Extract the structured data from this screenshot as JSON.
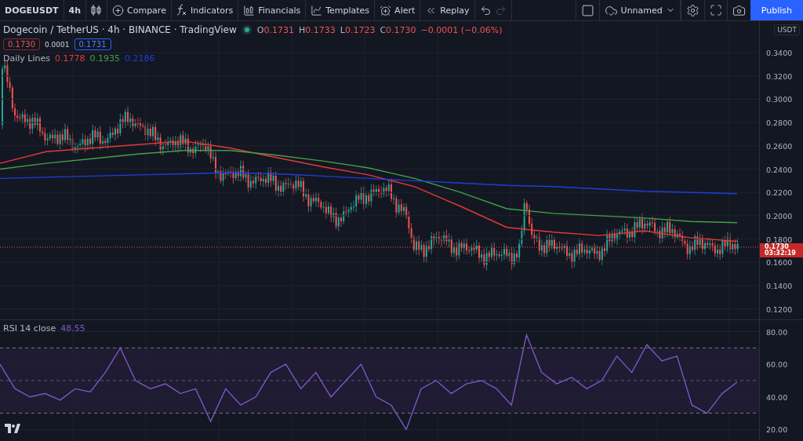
{
  "toolbar": {
    "symbol": "DOGEUSDT",
    "interval": "4h",
    "tools": [
      {
        "kind": "compare",
        "label": "Compare"
      },
      {
        "kind": "indicators",
        "label": "Indicators"
      },
      {
        "kind": "financials",
        "label": "Financials"
      },
      {
        "kind": "templates",
        "label": "Templates"
      },
      {
        "kind": "alert",
        "label": "Alert"
      },
      {
        "kind": "replay",
        "label": "Replay"
      }
    ],
    "layout_name": "Unnamed",
    "publish": "Publish"
  },
  "legend": {
    "title": "Dogecoin / TetherUS · 4h · BINANCE · TradingView",
    "ohlc": [
      {
        "label": "O",
        "value": "0.1731"
      },
      {
        "label": "H",
        "value": "0.1733"
      },
      {
        "label": "L",
        "value": "0.1723"
      },
      {
        "label": "C",
        "value": "0.1730"
      }
    ],
    "change": "−0.0001 (−0.06%)",
    "sell": "0.1730",
    "spread": "0.0001",
    "buy": "0.1731",
    "study": {
      "name": "Daily Lines",
      "values": [
        {
          "value": "0.1778",
          "color": "#e53935"
        },
        {
          "value": "0.1935",
          "color": "#43a047"
        },
        {
          "value": "0.2186",
          "color": "#1e3fd8"
        }
      ]
    }
  },
  "price_axis": {
    "currency": "USDT",
    "last_price": "0.1730",
    "countdown": "03:32:19"
  },
  "chart_data": {
    "type": "line",
    "grid": true,
    "ylim": [
      0.111,
      0.367
    ],
    "categories": [
      null,
      null,
      null,
      null,
      null,
      null,
      null,
      null,
      null,
      null,
      null,
      null,
      null,
      null,
      null,
      null,
      null
    ],
    "yticks": [
      {
        "value": 0.34,
        "label": "0.3400"
      },
      {
        "value": 0.32,
        "label": "0.3200"
      },
      {
        "value": 0.3,
        "label": "0.3000"
      },
      {
        "value": 0.28,
        "label": "0.2800"
      },
      {
        "value": 0.26,
        "label": "0.2600"
      },
      {
        "value": 0.24,
        "label": "0.2400"
      },
      {
        "value": 0.22,
        "label": "0.2200"
      },
      {
        "value": 0.2,
        "label": "0.2000"
      },
      {
        "value": 0.18,
        "label": "0.1800"
      },
      {
        "value": 0.16,
        "label": "0.1600"
      },
      {
        "value": 0.14,
        "label": "0.1400"
      },
      {
        "value": 0.12,
        "label": "0.1200"
      }
    ],
    "series": [
      {
        "color": "#e53935",
        "values": [
          0.245,
          0.255,
          0.258,
          0.261,
          0.264,
          0.258,
          0.25,
          0.242,
          0.235,
          0.225,
          0.208,
          0.19,
          0.186,
          0.183,
          0.187,
          0.181,
          0.178
        ]
      },
      {
        "color": "#43a047",
        "values": [
          0.24,
          0.245,
          0.249,
          0.253,
          0.256,
          0.256,
          0.252,
          0.247,
          0.241,
          0.232,
          0.22,
          0.206,
          0.202,
          0.2,
          0.198,
          0.195,
          0.194
        ]
      },
      {
        "color": "#1e3fd8",
        "values": [
          0.232,
          0.233,
          0.234,
          0.235,
          0.236,
          0.237,
          0.236,
          0.234,
          0.232,
          0.23,
          0.228,
          0.226,
          0.225,
          0.223,
          0.221,
          0.22,
          0.219
        ]
      }
    ]
  },
  "rsi": {
    "name": "RSI 14 close",
    "value": "48.55",
    "chart_data": {
      "type": "line",
      "grid": true,
      "ylim": [
        12,
        87
      ],
      "categories": [
        null,
        null,
        null,
        null,
        null,
        null,
        null,
        null,
        null,
        null,
        null,
        null,
        null,
        null,
        null,
        null,
        null,
        null,
        null,
        null,
        null,
        null,
        null,
        null,
        null,
        null,
        null,
        null,
        null,
        null,
        null,
        null,
        null,
        null,
        null,
        null,
        null,
        null,
        null,
        null,
        null,
        null,
        null,
        null,
        null,
        null,
        null,
        null,
        null,
        null
      ],
      "yticks": [
        {
          "value": 80,
          "label": "80.00"
        },
        {
          "value": 60,
          "label": "60.00"
        },
        {
          "value": 40,
          "label": "40.00"
        },
        {
          "value": 20,
          "label": "20.00"
        }
      ],
      "series": [
        {
          "color": "#7e57c2",
          "values": [
            60,
            45,
            40,
            42,
            38,
            45,
            43,
            55,
            70,
            50,
            45,
            48,
            42,
            45,
            25,
            45,
            35,
            40,
            55,
            60,
            45,
            55,
            40,
            50,
            60,
            40,
            35,
            20,
            45,
            50,
            42,
            48,
            50,
            45,
            35,
            78,
            55,
            48,
            52,
            45,
            50,
            65,
            55,
            72,
            62,
            65,
            35,
            30,
            42,
            49
          ]
        }
      ]
    }
  }
}
